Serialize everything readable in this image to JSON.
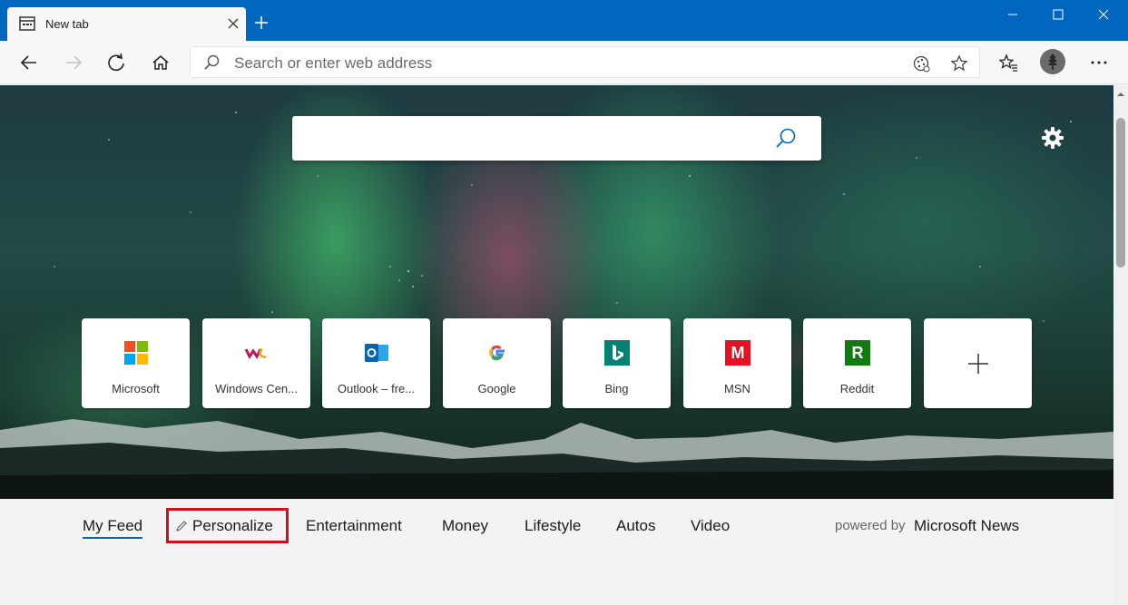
{
  "window": {
    "tab_title": "New tab"
  },
  "toolbar": {
    "address_placeholder": "Search or enter web address"
  },
  "top_sites": [
    {
      "label": "Microsoft",
      "icon": "microsoft-logo-icon"
    },
    {
      "label": "Windows Cen...",
      "icon": "windows-central-logo-icon"
    },
    {
      "label": "Outlook – fre...",
      "icon": "outlook-logo-icon"
    },
    {
      "label": "Google",
      "icon": "google-logo-icon"
    },
    {
      "label": "Bing",
      "icon": "bing-logo-icon"
    },
    {
      "label": "MSN",
      "icon": "msn-logo-icon"
    },
    {
      "label": "Reddit",
      "icon": "reddit-logo-icon"
    }
  ],
  "tile_letters": {
    "msn": "M",
    "reddit": "R",
    "google": "G"
  },
  "feed": {
    "tabs": [
      "My Feed",
      "Personalize",
      "Entertainment",
      "Money",
      "Lifestyle",
      "Autos",
      "Video"
    ],
    "powered_by": "powered by",
    "powered_brand": "Microsoft News"
  },
  "colors": {
    "accent": "#0067c0",
    "highlight_box": "#d0101b",
    "msn_red": "#e81123",
    "reddit_green": "#107c10",
    "bing_teal": "#008373"
  }
}
